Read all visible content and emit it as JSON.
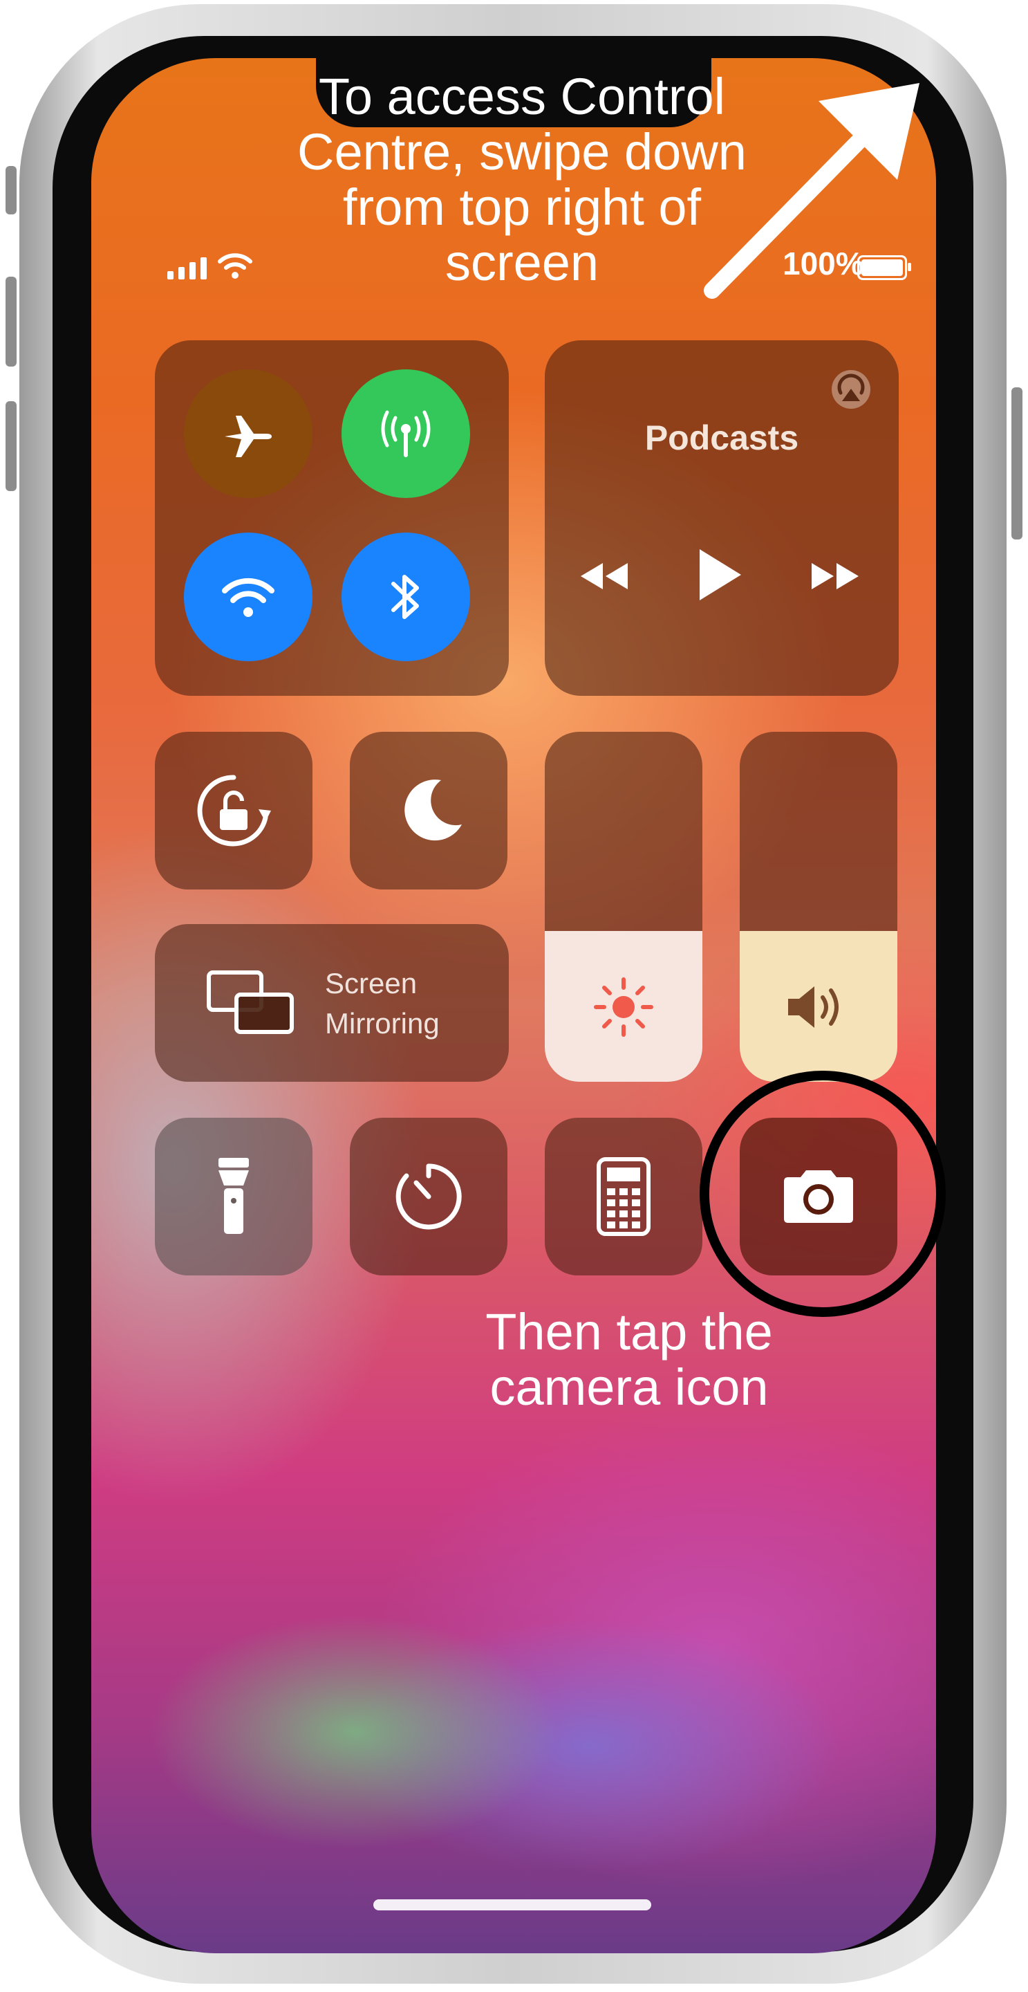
{
  "annotations": {
    "top": "To access Control Centre, swipe down from top right of screen",
    "bottom": "Then tap the camera icon"
  },
  "status_bar": {
    "battery": "100%"
  },
  "control_centre": {
    "connectivity": {
      "airplane": "airplane-icon",
      "cellular": "cellular-antenna-icon",
      "wifi": "wifi-icon",
      "bluetooth": "bluetooth-icon"
    },
    "media": {
      "title": "Podcasts",
      "controls": [
        "rewind-icon",
        "play-icon",
        "fast-forward-icon"
      ]
    },
    "screen_mirroring": {
      "line1": "Screen",
      "line2": "Mirroring"
    },
    "brightness_level": 0.43,
    "volume_level": 0.43,
    "bottom_row": [
      "flashlight-icon",
      "timer-icon",
      "calculator-icon",
      "camera-icon"
    ]
  },
  "colors": {
    "airplane_bg": "#8a4a0c",
    "cellular_bg": "#34c759",
    "wifi_bg": "#1a84ff",
    "bluetooth_bg": "#1a84ff",
    "annotation_text": "#ffffff",
    "highlight_ring": "#000000"
  }
}
